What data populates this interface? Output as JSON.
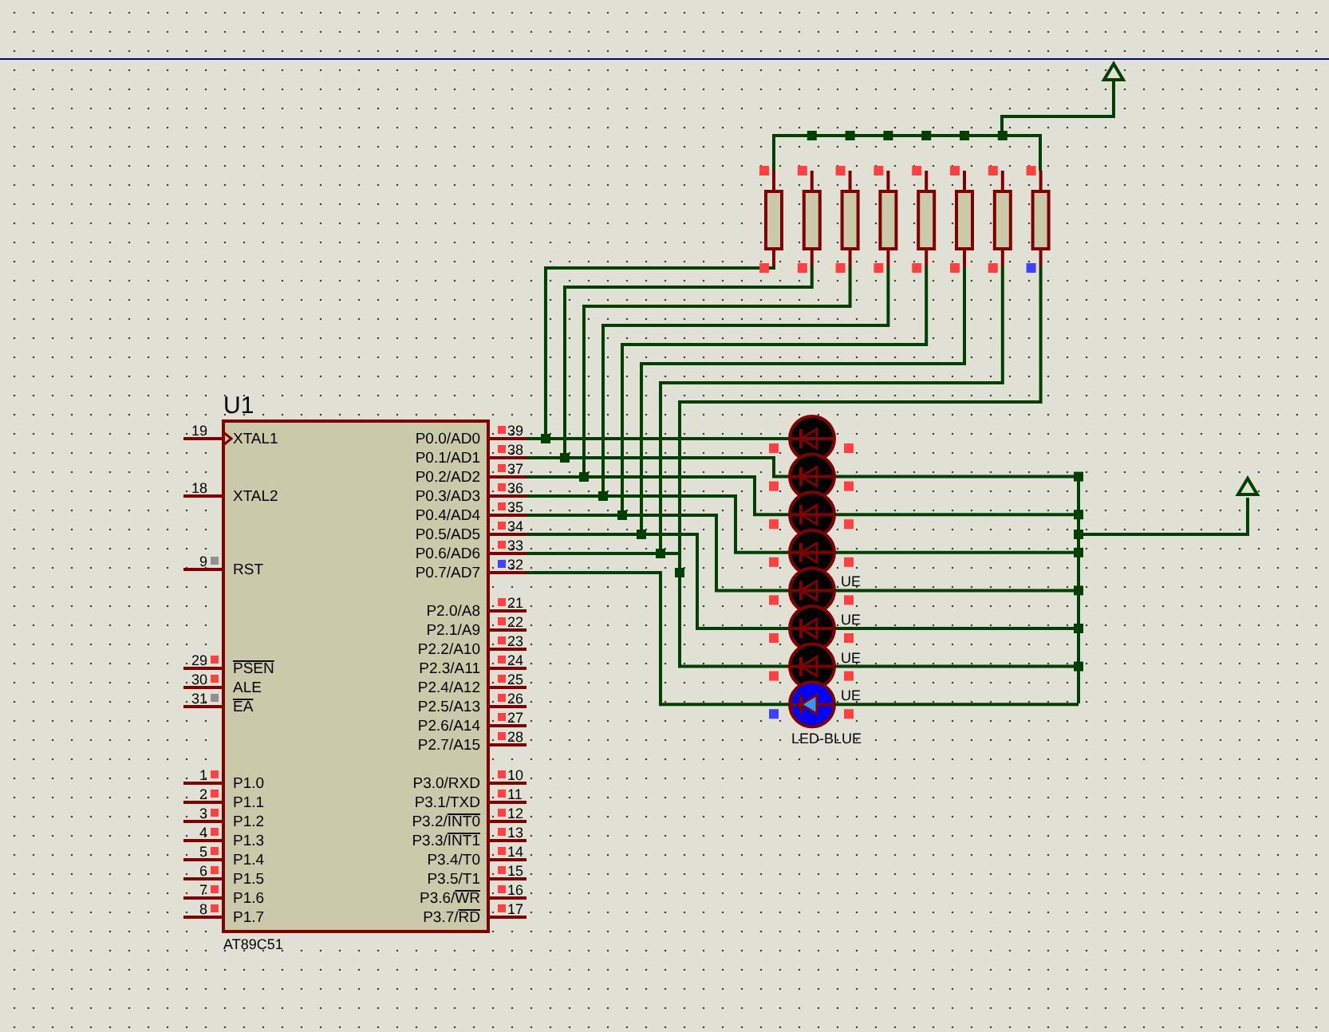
{
  "chip": {
    "ref": "U1",
    "part": "AT89C51",
    "left_pins": [
      {
        "num": "19",
        "name": "XTAL1",
        "clock": true
      },
      {
        "num": "18",
        "name": "XTAL2"
      },
      {
        "num": "9",
        "name": "RST",
        "color": "#909090"
      },
      {
        "num": "29",
        "name_bar": "PSEN",
        "color": "#ff4040"
      },
      {
        "num": "30",
        "name": "ALE",
        "color": "#ff4040"
      },
      {
        "num": "31",
        "name_bar": "EA",
        "color": "#909090"
      },
      {
        "num": "1",
        "name": "P1.0",
        "color": "#ff4040"
      },
      {
        "num": "2",
        "name": "P1.1",
        "color": "#ff4040"
      },
      {
        "num": "3",
        "name": "P1.2",
        "color": "#ff4040"
      },
      {
        "num": "4",
        "name": "P1.3",
        "color": "#ff4040"
      },
      {
        "num": "5",
        "name": "P1.4",
        "color": "#ff4040"
      },
      {
        "num": "6",
        "name": "P1.5",
        "color": "#ff4040"
      },
      {
        "num": "7",
        "name": "P1.6",
        "color": "#ff4040"
      },
      {
        "num": "8",
        "name": "P1.7",
        "color": "#ff4040"
      }
    ],
    "right_pins": [
      {
        "num": "39",
        "name": "P0.0/AD0",
        "color": "#ff4040"
      },
      {
        "num": "38",
        "name": "P0.1/AD1",
        "color": "#ff4040"
      },
      {
        "num": "37",
        "name": "P0.2/AD2",
        "color": "#ff4040"
      },
      {
        "num": "36",
        "name": "P0.3/AD3",
        "color": "#ff4040"
      },
      {
        "num": "35",
        "name": "P0.4/AD4",
        "color": "#ff4040"
      },
      {
        "num": "34",
        "name": "P0.5/AD5",
        "color": "#ff4040"
      },
      {
        "num": "33",
        "name": "P0.6/AD6",
        "color": "#ff4040"
      },
      {
        "num": "32",
        "name": "P0.7/AD7",
        "color": "#4040ff"
      },
      {
        "num": "21",
        "name": "P2.0/A8",
        "color": "#ff4040"
      },
      {
        "num": "22",
        "name": "P2.1/A9",
        "color": "#ff4040"
      },
      {
        "num": "23",
        "name": "P2.2/A10",
        "color": "#ff4040"
      },
      {
        "num": "24",
        "name": "P2.3/A11",
        "color": "#ff4040"
      },
      {
        "num": "25",
        "name": "P2.4/A12",
        "color": "#ff4040"
      },
      {
        "num": "26",
        "name": "P2.5/A13",
        "color": "#ff4040"
      },
      {
        "num": "27",
        "name": "P2.6/A14",
        "color": "#ff4040"
      },
      {
        "num": "28",
        "name": "P2.7/A15",
        "color": "#ff4040"
      },
      {
        "num": "10",
        "name": "P3.0/RXD",
        "color": "#ff4040"
      },
      {
        "num": "11",
        "name": "P3.1/TXD",
        "color": "#ff4040"
      },
      {
        "num": "12",
        "name": "P3.2/",
        "name_bar": "INT0",
        "color": "#ff4040"
      },
      {
        "num": "13",
        "name": "P3.3/",
        "name_bar": "INT1",
        "color": "#ff4040"
      },
      {
        "num": "14",
        "name": "P3.4/T0",
        "color": "#ff4040"
      },
      {
        "num": "15",
        "name": "P3.5/T1",
        "color": "#ff4040"
      },
      {
        "num": "16",
        "name": "P3.6/",
        "name_bar": "WR",
        "color": "#ff4040"
      },
      {
        "num": "17",
        "name": "P3.7/",
        "name_bar": "RD",
        "color": "#ff4040"
      }
    ]
  },
  "resistors": [
    {
      "top": {
        "color": "#ff4040"
      },
      "bottom": {
        "color": "#ff4040"
      }
    },
    {
      "top": {
        "color": "#ff4040"
      },
      "bottom": {
        "color": "#ff4040"
      }
    },
    {
      "top": {
        "color": "#ff4040"
      },
      "bottom": {
        "color": "#ff4040"
      }
    },
    {
      "top": {
        "color": "#ff4040"
      },
      "bottom": {
        "color": "#ff4040"
      }
    },
    {
      "top": {
        "color": "#ff4040"
      },
      "bottom": {
        "color": "#ff4040"
      }
    },
    {
      "top": {
        "color": "#ff4040"
      },
      "bottom": {
        "color": "#ff4040"
      }
    },
    {
      "top": {
        "color": "#ff4040"
      },
      "bottom": {
        "color": "#ff4040"
      }
    },
    {
      "top": {
        "color": "#ff4040"
      },
      "bottom": {
        "color": "#4040ff"
      }
    }
  ],
  "leds": [
    {
      "lit": false,
      "left": {
        "color": "#ff4040"
      },
      "right": {
        "color": "#ff4040"
      }
    },
    {
      "lit": false,
      "left": {
        "color": "#ff4040"
      },
      "right": {
        "color": "#ff4040"
      }
    },
    {
      "lit": false,
      "left": {
        "color": "#ff4040"
      },
      "right": {
        "color": "#ff4040"
      }
    },
    {
      "lit": false,
      "left": {
        "color": "#ff4040"
      },
      "right": {
        "color": "#ff4040"
      }
    },
    {
      "lit": false,
      "left": {
        "color": "#ff4040"
      },
      "right": {
        "color": "#ff4040"
      },
      "label": "UE"
    },
    {
      "lit": false,
      "left": {
        "color": "#ff4040"
      },
      "right": {
        "color": "#ff4040"
      },
      "label": "UE"
    },
    {
      "lit": false,
      "left": {
        "color": "#ff4040"
      },
      "right": {
        "color": "#ff4040"
      },
      "label": "UE"
    },
    {
      "lit": true,
      "left": {
        "color": "#4040ff"
      },
      "right": {
        "color": "#ff4040"
      },
      "label": "UE"
    }
  ],
  "led_caption": "LED-BLUE"
}
